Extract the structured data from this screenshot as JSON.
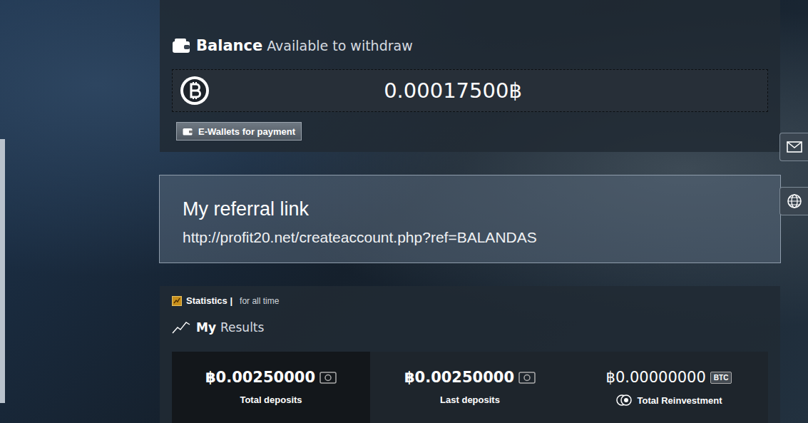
{
  "balance": {
    "title": "Balance",
    "subtitle": "Available to withdraw",
    "value": "0.00017500฿",
    "button": "E-Wallets for payment"
  },
  "referral": {
    "title": "My referral link",
    "link": "http://profit20.net/createaccount.php?ref=BALANDAS"
  },
  "statistics": {
    "title": "Statistics |",
    "period": "for all time",
    "heading_bold": "My",
    "heading": "Results",
    "cards": [
      {
        "kind": "deposit",
        "value": "฿0.00250000",
        "label": "Total deposits",
        "badge": "",
        "selected": true
      },
      {
        "kind": "deposit",
        "value": "฿0.00250000",
        "label": "Last deposits",
        "badge": "",
        "selected": false
      },
      {
        "kind": "reinvest",
        "value": "฿0.00000000",
        "label": "Total Reinvestment",
        "badge": "BTC",
        "selected": false
      }
    ]
  }
}
